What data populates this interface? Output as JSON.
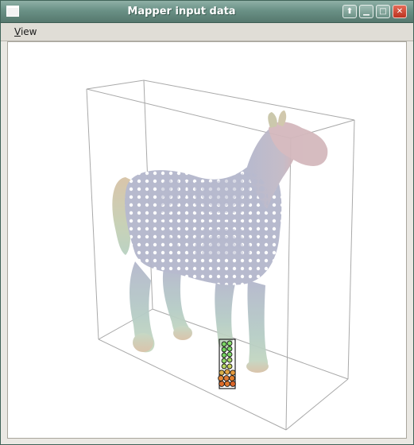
{
  "window": {
    "title": "Mapper input data"
  },
  "titlebar_buttons": [
    {
      "name": "shade-button",
      "glyph": "⬆"
    },
    {
      "name": "minimize-button",
      "glyph": "▁"
    },
    {
      "name": "maximize-button",
      "glyph": "□"
    },
    {
      "name": "close-button",
      "glyph": "✕"
    }
  ],
  "menu": {
    "view_mnemonic": "V",
    "view_rest": "iew"
  },
  "scene": {
    "description_icon": "point-cloud-horse",
    "colors": {
      "body": "#b4b7cc",
      "head_tint": "#d9b4b4",
      "tail_tint": "#d9c7a8",
      "leg_tint": "#b9d4c3",
      "selected_green": "#6fcf5a",
      "selected_orange": "#e0772d",
      "box_lines": "#a9a9a9"
    }
  }
}
